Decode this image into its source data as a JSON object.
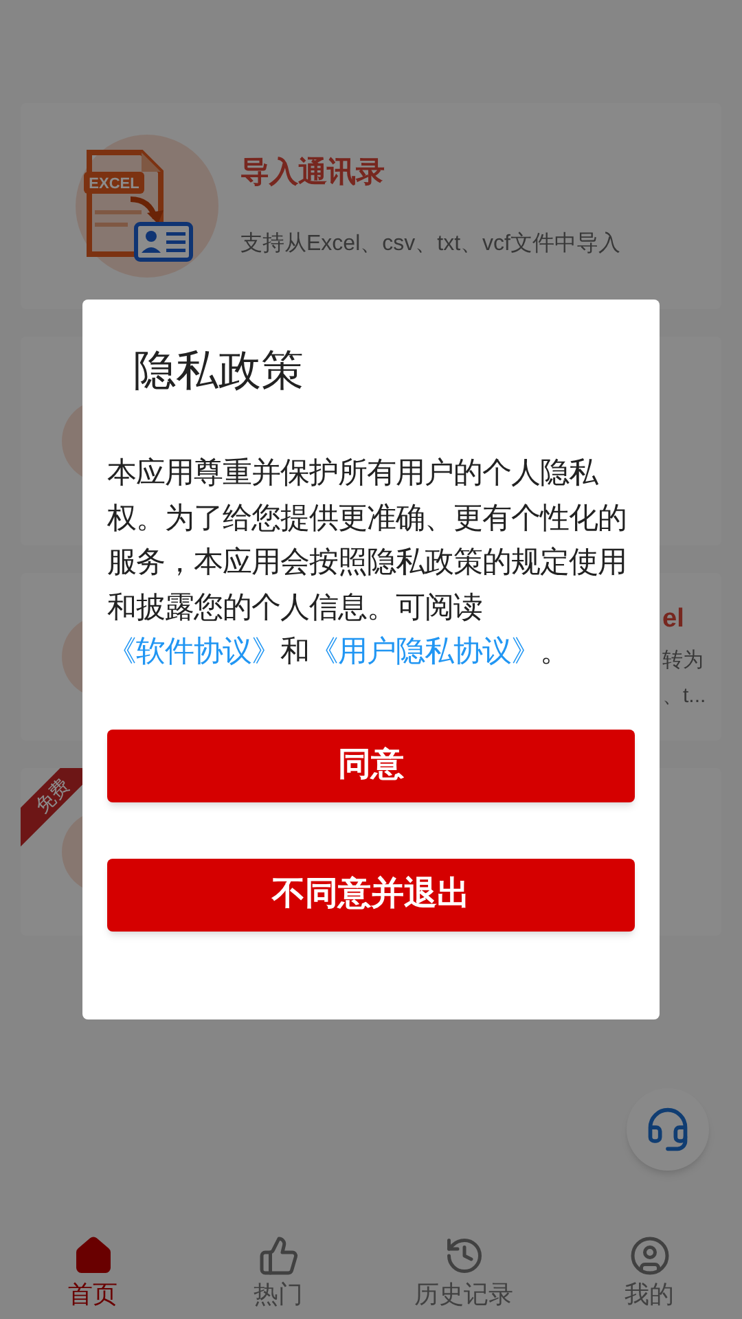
{
  "cards": [
    {
      "kind": "import",
      "icon_label": "EXCEL",
      "title": "导入通讯录",
      "description": "支持从Excel、csv、txt、vcf文件中导入"
    },
    {
      "kind": "blank"
    },
    {
      "kind": "partial",
      "title": "el",
      "lines": [
        "转为",
        "、t..."
      ]
    },
    {
      "kind": "ribbon",
      "ribbon": "免费"
    }
  ],
  "dialog": {
    "title": "隐私政策",
    "body": [
      {
        "kind": "text",
        "text": "本应用尊重并保护所有用户的个人隐私权。为了给您提供更准确、更有个性化的服务，本应用会按照隐私政策的规定使用和披露您的个人信息。可阅读"
      },
      {
        "kind": "link",
        "text": "《软件协议》"
      },
      {
        "kind": "text",
        "text": "和"
      },
      {
        "kind": "link",
        "text": "《用户隐私协议》"
      },
      {
        "kind": "text",
        "text": "。"
      }
    ],
    "buttons": [
      "同意",
      "不同意并退出"
    ]
  },
  "nav": [
    {
      "label": "首页",
      "selected": true
    },
    {
      "label": "热门",
      "selected": false
    },
    {
      "label": "历史记录",
      "selected": false
    },
    {
      "label": "我的",
      "selected": false
    }
  ]
}
